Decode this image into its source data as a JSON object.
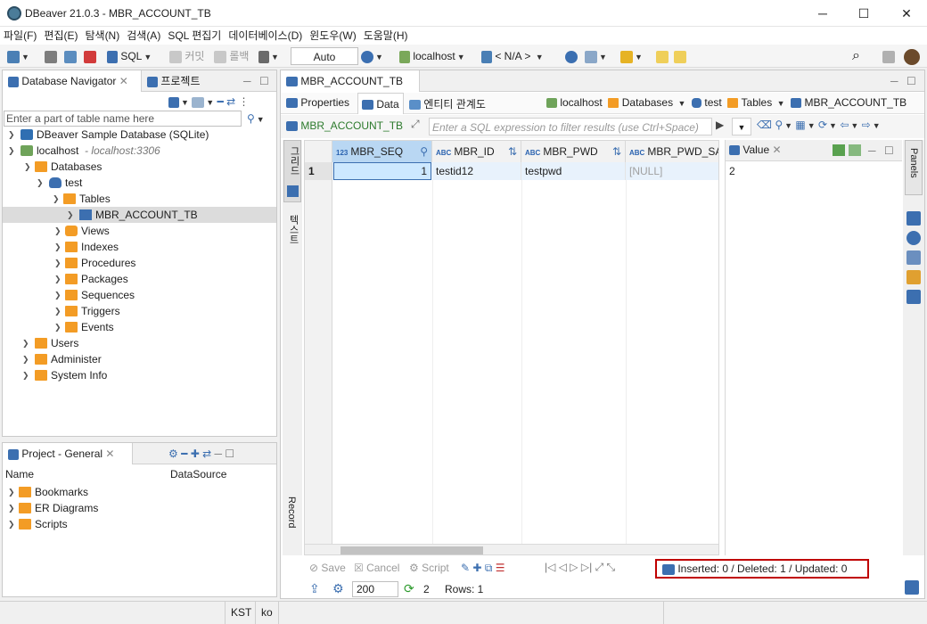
{
  "window": {
    "title": "DBeaver 21.0.3 - MBR_ACCOUNT_TB",
    "minimize": "─",
    "maximize": "☐",
    "close": "✕"
  },
  "menu": [
    "파일(F)",
    "편집(E)",
    "탐색(N)",
    "검색(A)",
    "SQL 편집기",
    "데이터베이스(D)",
    "윈도우(W)",
    "도움말(H)"
  ],
  "toolbar": {
    "sql": "SQL",
    "commit": "커밋",
    "rollback": "롤백",
    "transaction_mode": "Auto",
    "connection": "localhost",
    "schema": "< N/A >"
  },
  "navigator": {
    "tab": "Database Navigator",
    "tab2": "프로젝트",
    "filter_placeholder": "Enter a part of table name here",
    "tree": [
      {
        "label": "DBeaver Sample Database (SQLite)"
      },
      {
        "label": "localhost",
        "sub": "- localhost:3306"
      },
      {
        "label": "Databases"
      },
      {
        "label": "test"
      },
      {
        "label": "Tables"
      },
      {
        "label": "MBR_ACCOUNT_TB"
      },
      {
        "label": "Views"
      },
      {
        "label": "Indexes"
      },
      {
        "label": "Procedures"
      },
      {
        "label": "Packages"
      },
      {
        "label": "Sequences"
      },
      {
        "label": "Triggers"
      },
      {
        "label": "Events"
      },
      {
        "label": "Users"
      },
      {
        "label": "Administer"
      },
      {
        "label": "System Info"
      }
    ]
  },
  "project": {
    "tab": "Project - General",
    "col_name": "Name",
    "col_datasource": "DataSource",
    "items": [
      "Bookmarks",
      "ER Diagrams",
      "Scripts"
    ]
  },
  "editor": {
    "tab": "MBR_ACCOUNT_TB",
    "subtabs": [
      "Properties",
      "Data",
      "엔티티 관계도"
    ],
    "breadcrumb": [
      "localhost",
      "Databases",
      "test",
      "Tables",
      "MBR_ACCOUNT_TB"
    ],
    "filter_table": "MBR_ACCOUNT_TB",
    "filter_placeholder": "Enter a SQL expression to filter results (use Ctrl+Space)",
    "side_tabs": {
      "grid": "그리드",
      "text": "텍스트",
      "record": "Record"
    },
    "columns": [
      "MBR_SEQ",
      "MBR_ID",
      "MBR_PWD",
      "MBR_PWD_SA"
    ],
    "col_type": {
      "num": "123",
      "abc": "ABC"
    },
    "rows": [
      {
        "num": "1",
        "cells": [
          "1",
          "testid12",
          "testpwd",
          "[NULL]"
        ]
      }
    ],
    "value_panel": {
      "tab": "Value",
      "value": "2"
    },
    "panels_tab": "Panels",
    "actions": {
      "save": "Save",
      "cancel": "Cancel",
      "script": "Script"
    },
    "status_changes": "Inserted: 0 / Deleted: 1 / Updated: 0",
    "fetch_size": "200",
    "refresh_count": "2",
    "rows_label": "Rows: 1"
  },
  "statusbar": {
    "tz": "KST",
    "locale": "ko"
  },
  "colors": {
    "accent_blue": "#2b63b0",
    "highlight_red": "#c00000",
    "folder_orange": "#f39c25",
    "selection": "#cde8ff"
  }
}
